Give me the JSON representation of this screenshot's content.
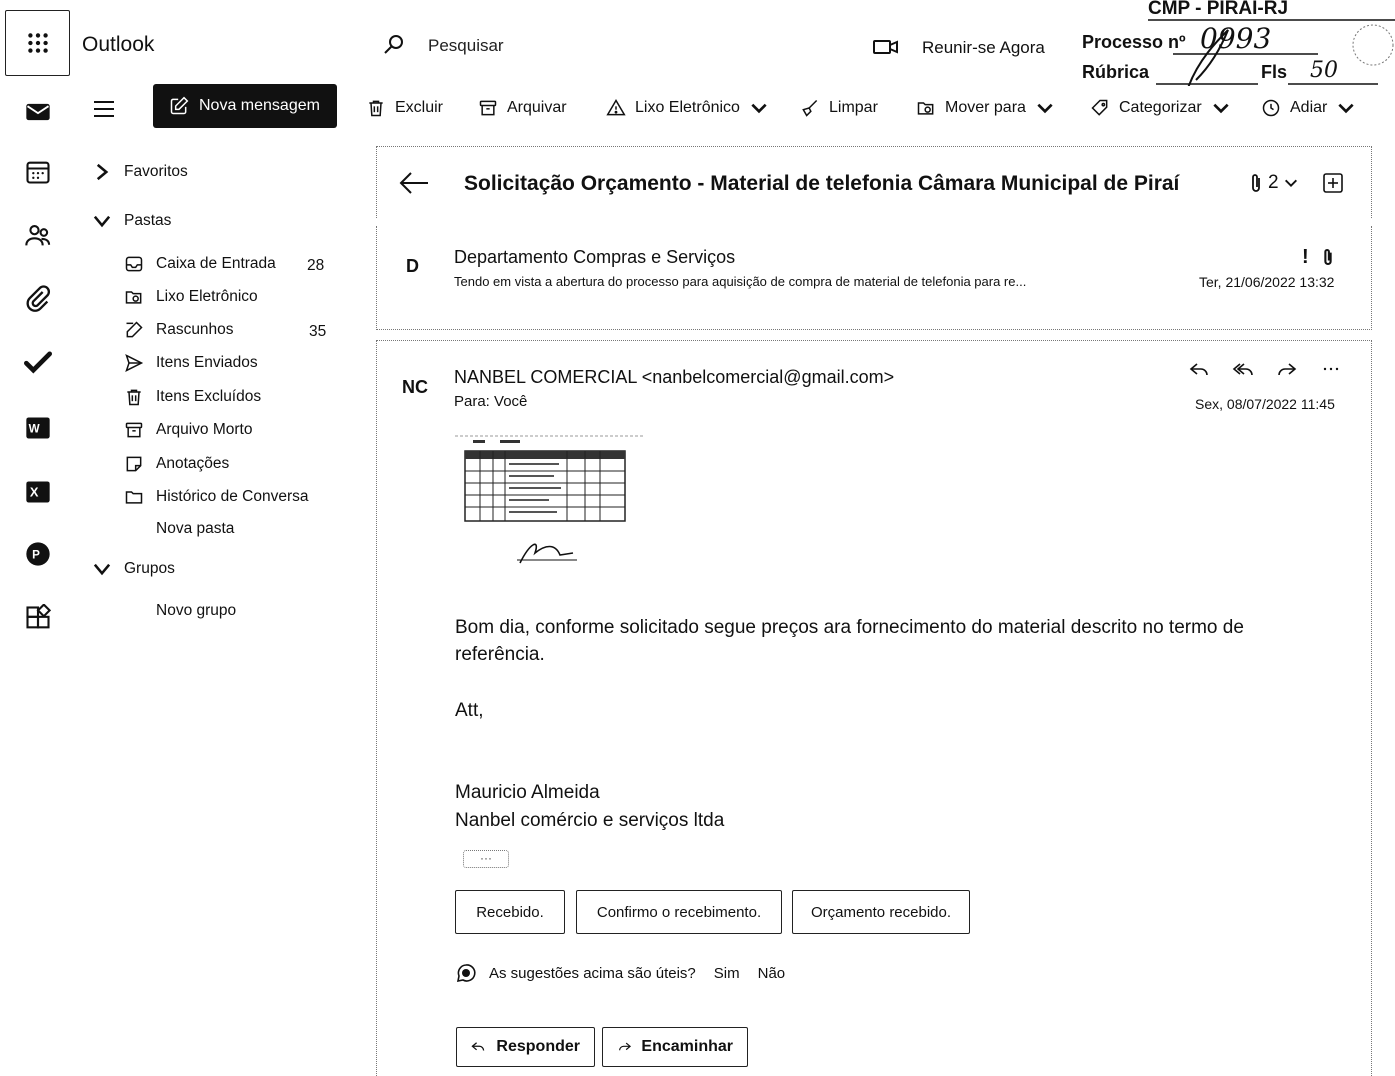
{
  "app": {
    "title": "Outlook"
  },
  "search": {
    "placeholder": "Pesquisar"
  },
  "header": {
    "meet_now": "Reunir-se Agora"
  },
  "stamp": {
    "title": "CMP - PIRAÍ-RJ",
    "processo_label": "Processo nº",
    "processo_value": "0993",
    "rubrica_label": "Rúbrica",
    "fls_label": "Fls",
    "fls_value": "50"
  },
  "toolbar": {
    "new_message": "Nova mensagem",
    "delete": "Excluir",
    "archive": "Arquivar",
    "junk": "Lixo Eletrônico",
    "sweep": "Limpar",
    "move_to": "Mover para",
    "categorize": "Categorizar",
    "snooze": "Adiar"
  },
  "nav": {
    "favorites": "Favoritos",
    "folders": "Pastas",
    "items": [
      {
        "label": "Caixa de Entrada",
        "count": "28",
        "icon": "inbox-icon"
      },
      {
        "label": "Lixo Eletrônico",
        "count": "",
        "icon": "junk-icon"
      },
      {
        "label": "Rascunhos",
        "count": "35",
        "icon": "drafts-icon"
      },
      {
        "label": "Itens Enviados",
        "count": "",
        "icon": "sent-icon"
      },
      {
        "label": "Itens Excluídos",
        "count": "",
        "icon": "deleted-icon"
      },
      {
        "label": "Arquivo Morto",
        "count": "",
        "icon": "archive-icon"
      },
      {
        "label": "Anotações",
        "count": "",
        "icon": "notes-icon"
      },
      {
        "label": "Histórico de Conversa",
        "count": "",
        "icon": "folder-icon"
      }
    ],
    "new_folder": "Nova pasta",
    "groups": "Grupos",
    "new_group": "Novo grupo"
  },
  "thread": {
    "subject": "Solicitação Orçamento - Material de telefonia Câmara Municipal de Piraí",
    "attachment_count": "2",
    "messages": [
      {
        "avatar": "D",
        "sender": "Departamento Compras e Serviços",
        "preview": "Tendo em vista a abertura do processo para aquisição de compra de material de telefonia para re...",
        "date": "Ter, 21/06/2022 13:32",
        "flag_important": "!"
      },
      {
        "avatar": "NC",
        "sender": "NANBEL COMERCIAL <nanbelcomercial@gmail.com>",
        "to": "Para: Você",
        "date": "Sex, 08/07/2022 11:45",
        "body_line1": "Bom dia, conforme solicitado segue preços ara fornecimento do material descrito no termo de",
        "body_line2": "referência.",
        "body_line3": "Att,",
        "signature_name": "Mauricio Almeida",
        "signature_company": "Nanbel comércio e serviços ltda",
        "more": "···"
      }
    ]
  },
  "suggestions": {
    "replies": [
      "Recebido.",
      "Confirmo o recebimento.",
      "Orçamento recebido."
    ],
    "feedback_question": "As sugestões acima são úteis?",
    "yes": "Sim",
    "no": "Não"
  },
  "reply": {
    "reply": "Responder",
    "forward": "Encaminhar"
  }
}
